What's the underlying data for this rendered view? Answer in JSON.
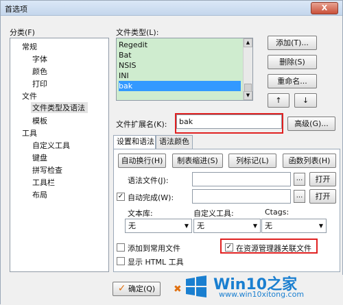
{
  "window": {
    "title": "首选项",
    "close": "X"
  },
  "category": {
    "label": "分类(F)",
    "items": [
      "常规",
      "字体",
      "颜色",
      "打印",
      "文件",
      "文件类型及语法",
      "模板",
      "工具",
      "自定义工具",
      "键盘",
      "拼写检查",
      "工具栏",
      "布局"
    ],
    "selected": "文件类型及语法"
  },
  "filetypes": {
    "label": "文件类型(L):",
    "items": [
      "Regedit",
      "Bat",
      "NSIS",
      "INI",
      "bak"
    ],
    "selected": "bak"
  },
  "buttons": {
    "add": "添加(T)...",
    "delete": "删除(S)",
    "rename": "重命名...",
    "up": "↑",
    "down": "↓",
    "advanced": "高级(G)..."
  },
  "extension": {
    "label": "文件扩展名(K):",
    "value": "bak"
  },
  "tabs": [
    "设置和语法",
    "语法颜色"
  ],
  "panel": {
    "btn_wrap": "自动换行(H)",
    "btn_tab": "制表缩进(S)",
    "btn_col": "列标记(L)",
    "btn_func": "函数列表(H)",
    "syntax_label": "语法文件(J):",
    "autocomplete_label": "自动完成(W):",
    "autocomplete_checked": true,
    "browse": "...",
    "open": "打开",
    "textlib_label": "文本库:",
    "customtool_label": "自定义工具:",
    "ctags_label": "Ctags:",
    "none": "无",
    "add_common": "添加到常用文件",
    "show_html": "显示 HTML 工具",
    "assoc_explorer": "在资源管理器关联文件",
    "assoc_checked": true
  },
  "footer": {
    "ok": "确定(Q)"
  },
  "watermark": {
    "title": "Win10",
    "title_suffix": "之家",
    "url": "www.win10xitong.com"
  },
  "colors": {
    "list_bg": "#cfeccf",
    "selection": "#3399ff",
    "highlight_box": "#e02020",
    "brand": "#1a7fd0"
  }
}
